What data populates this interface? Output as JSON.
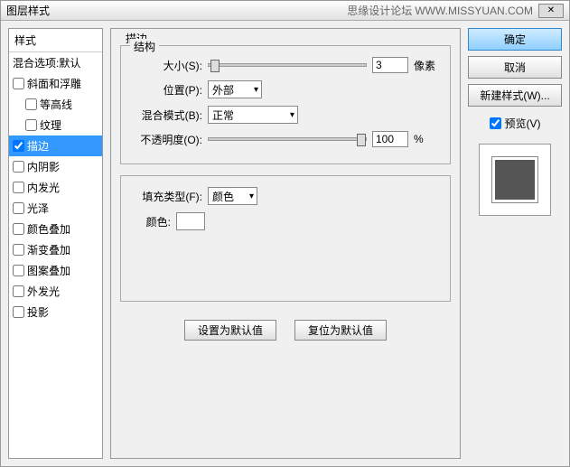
{
  "titlebar": {
    "title": "图层样式",
    "brand": "思缘设计论坛",
    "url": "WWW.MISSYUAN.COM"
  },
  "left": {
    "header": "样式",
    "items": [
      {
        "label": "混合选项:默认",
        "checked": false,
        "nocheck": true
      },
      {
        "label": "斜面和浮雕",
        "checked": false
      },
      {
        "label": "等高线",
        "checked": false,
        "indent": true
      },
      {
        "label": "纹理",
        "checked": false,
        "indent": true
      },
      {
        "label": "描边",
        "checked": true,
        "selected": true
      },
      {
        "label": "内阴影",
        "checked": false
      },
      {
        "label": "内发光",
        "checked": false
      },
      {
        "label": "光泽",
        "checked": false
      },
      {
        "label": "颜色叠加",
        "checked": false
      },
      {
        "label": "渐变叠加",
        "checked": false
      },
      {
        "label": "图案叠加",
        "checked": false
      },
      {
        "label": "外发光",
        "checked": false
      },
      {
        "label": "投影",
        "checked": false
      }
    ]
  },
  "center": {
    "title": "描边",
    "structure": {
      "legend": "结构",
      "size_label": "大小(S):",
      "size_value": "3",
      "size_unit": "像素",
      "position_label": "位置(P):",
      "position_value": "外部",
      "blend_label": "混合模式(B):",
      "blend_value": "正常",
      "opacity_label": "不透明度(O):",
      "opacity_value": "100",
      "opacity_unit": "%"
    },
    "fill": {
      "filltype_label": "填充类型(F):",
      "filltype_value": "颜色",
      "color_label": "颜色:",
      "color_value": "#ffffff"
    },
    "buttons": {
      "default": "设置为默认值",
      "reset": "复位为默认值"
    }
  },
  "right": {
    "ok": "确定",
    "cancel": "取消",
    "newstyle": "新建样式(W)...",
    "preview_label": "预览(V)",
    "preview_checked": true
  }
}
